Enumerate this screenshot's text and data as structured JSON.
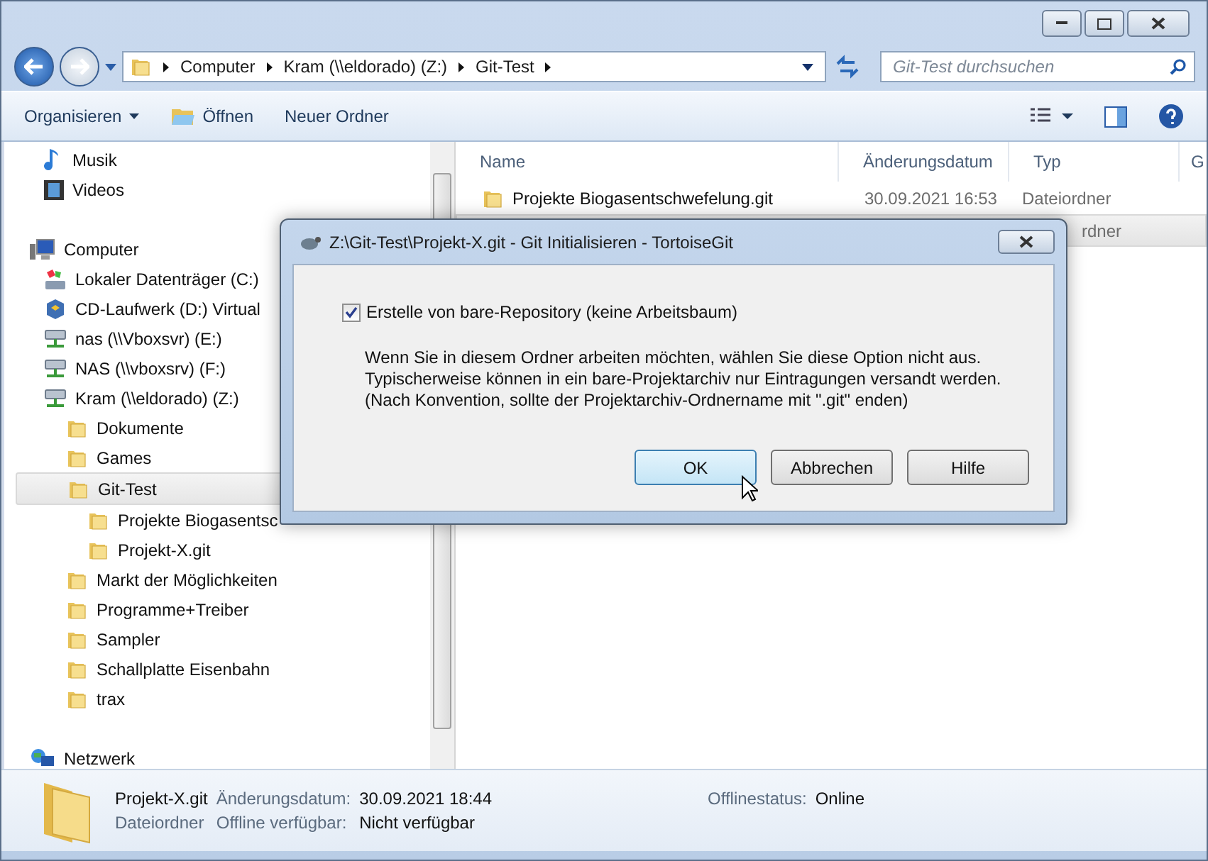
{
  "address": {
    "crumbs": [
      "Computer",
      "Kram (\\\\eldorado) (Z:)",
      "Git-Test"
    ]
  },
  "search": {
    "placeholder": "Git-Test durchsuchen"
  },
  "toolbar": [
    {
      "label": "Organisieren",
      "kind": "menu"
    },
    {
      "label": "Öffnen",
      "kind": "open"
    },
    {
      "label": "Neuer Ordner",
      "kind": "plain"
    }
  ],
  "nav": [
    {
      "nested": true,
      "items": [
        {
          "label": "Musik",
          "kind": "music",
          "selected": false
        },
        {
          "label": "Videos",
          "kind": "video",
          "selected": false
        }
      ]
    },
    {
      "nested": false,
      "items": [
        {
          "label": "Computer",
          "kind": "computer",
          "selected": false,
          "children": [
            {
              "label": "Lokaler Datenträger (C:)",
              "kind": "drive",
              "selected": false
            },
            {
              "label": "CD-Laufwerk (D:) Virtual",
              "kind": "cdrom",
              "selected": false
            },
            {
              "label": "nas (\\\\Vboxsvr) (E:)",
              "kind": "netdrive",
              "selected": false
            },
            {
              "label": "NAS (\\\\vboxsrv) (F:)",
              "kind": "netdrive",
              "selected": false
            },
            {
              "label": "Kram (\\\\eldorado) (Z:)",
              "kind": "netdrive",
              "selected": false,
              "children": [
                {
                  "label": "Dokumente",
                  "kind": "folder",
                  "selected": false
                },
                {
                  "label": "Games",
                  "kind": "folder",
                  "selected": false
                },
                {
                  "label": "Git-Test",
                  "kind": "folder",
                  "selected": true,
                  "children": [
                    {
                      "label": "Projekte Biogasentsc",
                      "kind": "folder",
                      "selected": false
                    },
                    {
                      "label": "Projekt-X.git",
                      "kind": "folder",
                      "selected": false
                    }
                  ]
                },
                {
                  "label": "Markt der Möglichkeiten",
                  "kind": "folder",
                  "selected": false
                },
                {
                  "label": "Programme+Treiber",
                  "kind": "folder",
                  "selected": false
                },
                {
                  "label": "Sampler",
                  "kind": "folder",
                  "selected": false
                },
                {
                  "label": "Schallplatte Eisenbahn",
                  "kind": "folder",
                  "selected": false
                },
                {
                  "label": "trax",
                  "kind": "folder",
                  "selected": false
                }
              ]
            }
          ]
        }
      ]
    },
    {
      "nested": false,
      "items": [
        {
          "label": "Netzwerk",
          "kind": "network",
          "selected": false
        }
      ]
    }
  ],
  "table": {
    "columns": [
      "Name",
      "Änderungsdatum",
      "Typ",
      "G"
    ],
    "rows": [
      {
        "name": "Projekte Biogasentschwefelung.git",
        "date": "30.09.2021 16:53",
        "type": "Dateiordner",
        "selected": false
      },
      {
        "type": "rdner",
        "selected": true
      }
    ]
  },
  "details": {
    "name": "Projekt-X.git",
    "type": "Dateiordner",
    "fields": [
      {
        "label": "Änderungsdatum:",
        "value": "30.09.2021 18:44"
      },
      {
        "label": "Offlinestatus:",
        "value": "Online"
      },
      {
        "label": "Offline verfügbar:",
        "value": "Nicht verfügbar"
      }
    ]
  },
  "dialog": {
    "title": "Z:\\Git-Test\\Projekt-X.git - Git Initialisieren - TortoiseGit",
    "checkbox": {
      "label": "Erstelle von bare-Repository (keine Arbeitsbaum)",
      "checked": true
    },
    "description": "Wenn Sie in diesem Ordner arbeiten möchten, wählen Sie diese Option nicht aus.\nTypischerweise können in ein bare-Projektarchiv nur Eintragungen versandt werden.\n(Nach Konvention, sollte der Projektarchiv-Ordnername mit \".git\" enden)",
    "buttons": [
      {
        "label": "OK",
        "default": true
      },
      {
        "label": "Abbrechen",
        "default": false
      },
      {
        "label": "Hilfe",
        "default": false
      }
    ]
  }
}
